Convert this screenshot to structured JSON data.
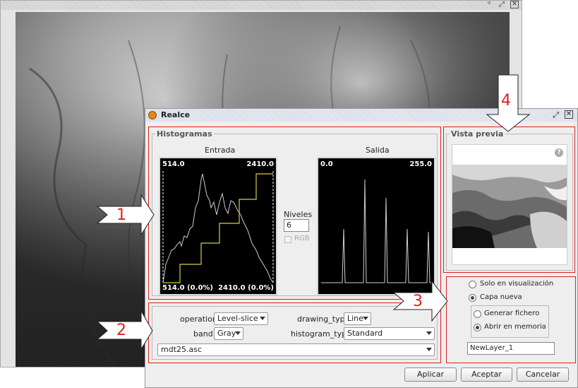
{
  "dialog": {
    "title": "Realce"
  },
  "histogramas": {
    "group_title": "Histogramas",
    "entrada": {
      "label": "Entrada",
      "min": "514.0",
      "max": "2410.0",
      "bottom_min": "514.0 (0.0%)",
      "bottom_max": "2410.0 (0.0%)"
    },
    "salida": {
      "label": "Salida",
      "min": "0.0",
      "max": "255.0"
    },
    "niveles_label": "Niveles",
    "niveles_value": "6",
    "rgb_label": "RGB"
  },
  "options": {
    "operation_label": "operation",
    "operation_value": "Level-slice",
    "band_label": "band",
    "band_value": "Gray",
    "drawing_type_label": "drawing_type",
    "drawing_type_value": "Line",
    "histogram_type_label": "histogram_type",
    "histogram_type_value": "Standard",
    "layer_value": "mdt25.asc"
  },
  "preview": {
    "group_title": "Vista previa"
  },
  "output": {
    "solo_visualizacion": "Solo en visualización",
    "capa_nueva": "Capa nueva",
    "generar_fichero": "Generar fichero",
    "abrir_memoria": "Abrir en memoria",
    "layer_name": "NewLayer_1"
  },
  "buttons": {
    "aplicar": "Aplicar",
    "aceptar": "Aceptar",
    "cancelar": "Cancelar"
  },
  "callouts": {
    "c1": "1",
    "c2": "2",
    "c3": "3",
    "c4": "4"
  },
  "icons": {
    "help": "question-icon",
    "app": "app-icon"
  }
}
